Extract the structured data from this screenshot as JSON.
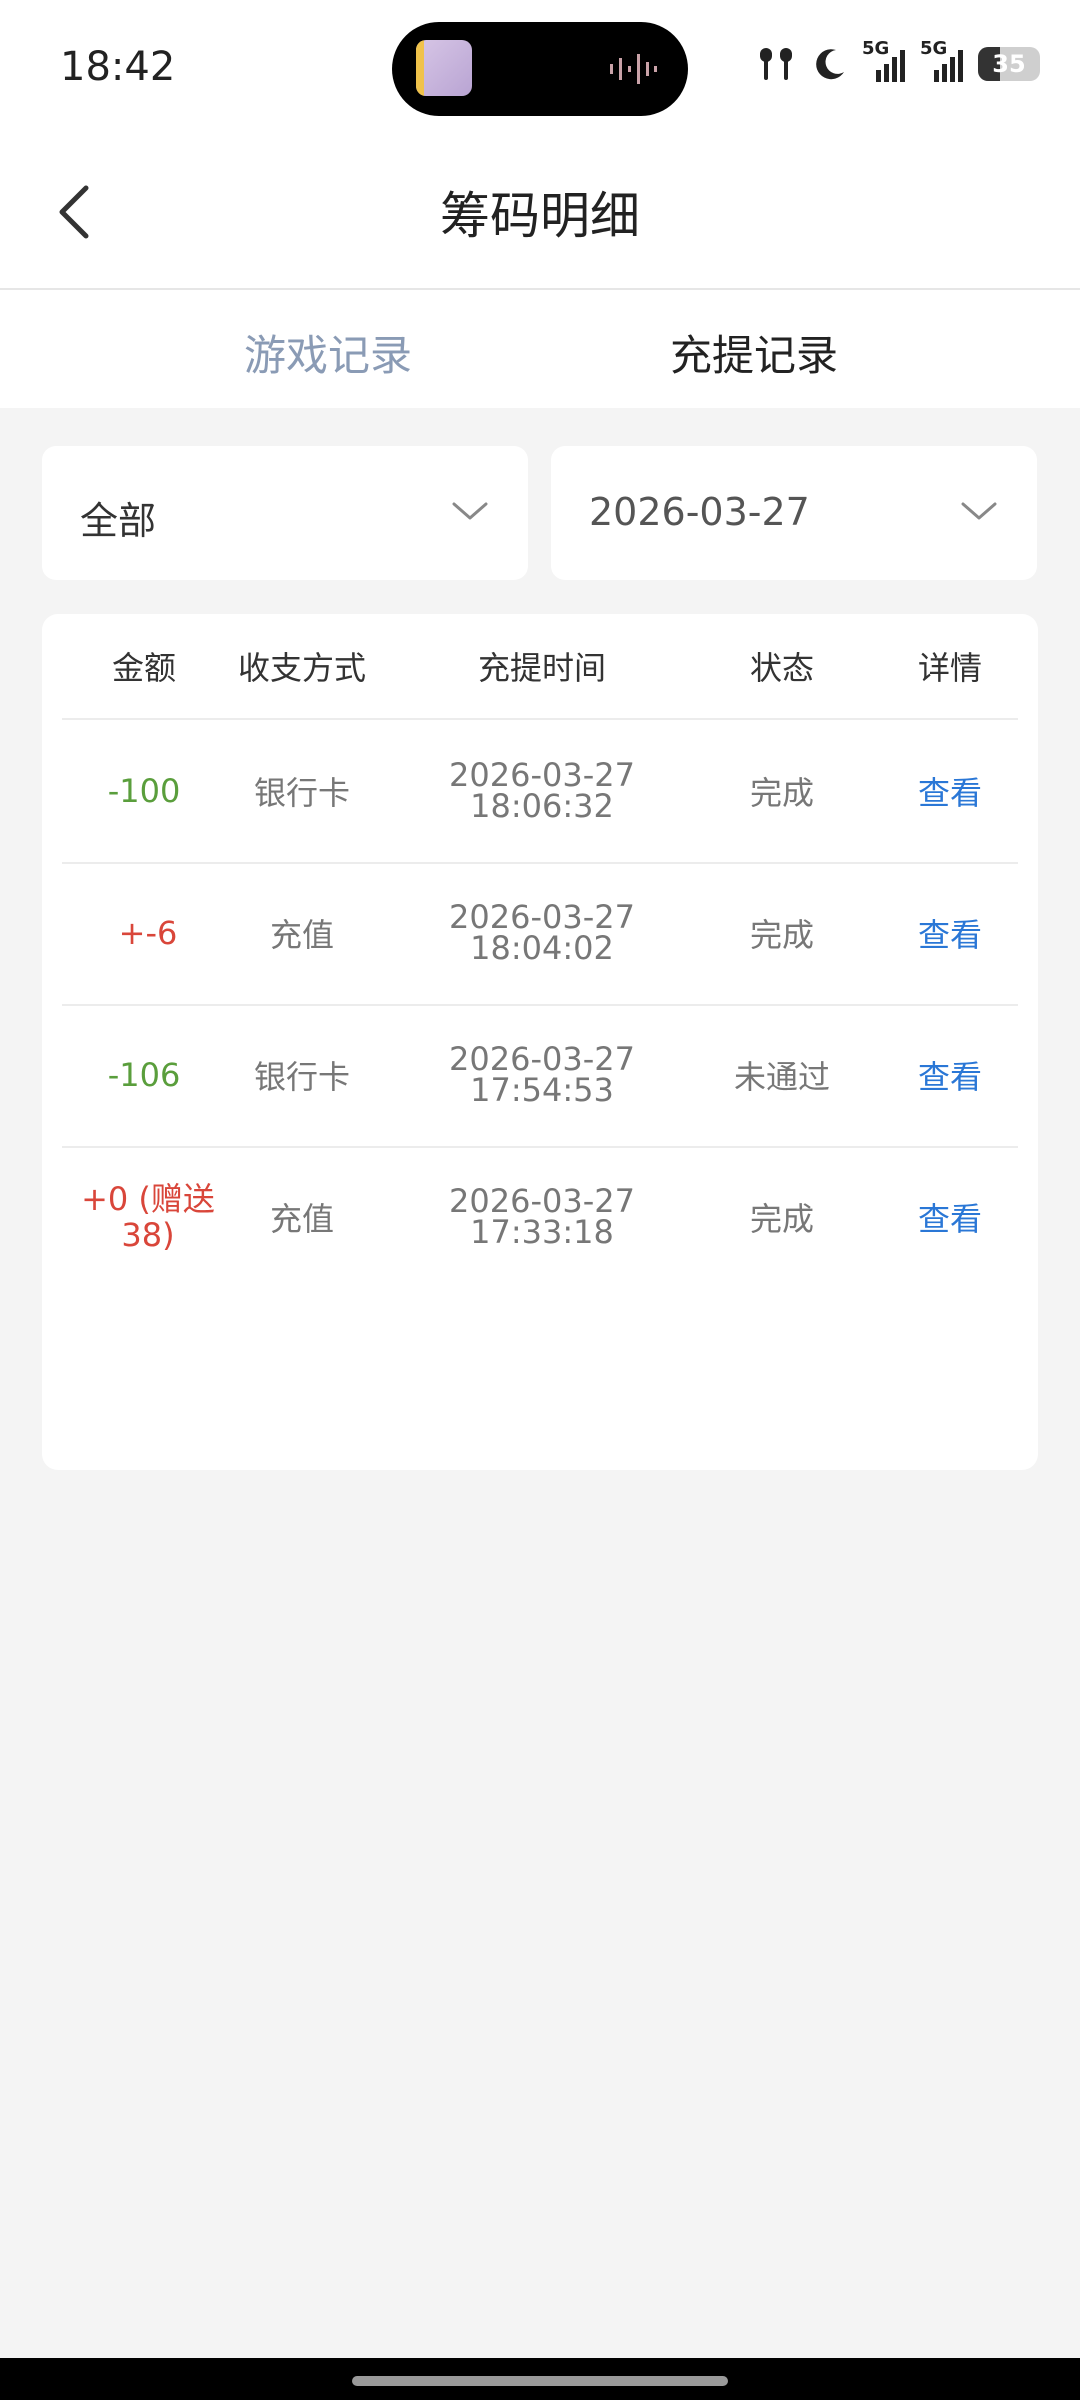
{
  "status_bar": {
    "time": "18:42",
    "battery": "35",
    "signal_label_1": "5G",
    "signal_label_2": "5G"
  },
  "header": {
    "title": "筹码明细"
  },
  "tabs": [
    {
      "label": "游戏记录",
      "active": false
    },
    {
      "label": "充提记录",
      "active": true
    }
  ],
  "filters": {
    "type": "全部",
    "date": "2026-03-27"
  },
  "table": {
    "columns": [
      "金额",
      "收支方式",
      "充提时间",
      "状态",
      "详情"
    ],
    "rows": [
      {
        "amount": "-100",
        "method": "银行卡",
        "time": "2026-03-27\n18:06:32",
        "status": "完成",
        "detail": "查看"
      },
      {
        "amount": "+-6",
        "method": "充值",
        "time": "2026-03-27\n18:04:02",
        "status": "完成",
        "detail": "查看"
      },
      {
        "amount": "-106",
        "method": "银行卡",
        "time": "2026-03-27\n17:54:53",
        "status": "未通过",
        "detail": "查看"
      },
      {
        "amount": "+0 (赠送38)",
        "method": "充值",
        "time": "2026-03-27\n17:33:18",
        "status": "完成",
        "detail": "查看"
      }
    ]
  },
  "colors": {
    "negative_amount": "#5a9e3c",
    "positive_amount": "#d9463a",
    "link": "#2a77d6",
    "inactive_tab": "#8a9bb5"
  }
}
